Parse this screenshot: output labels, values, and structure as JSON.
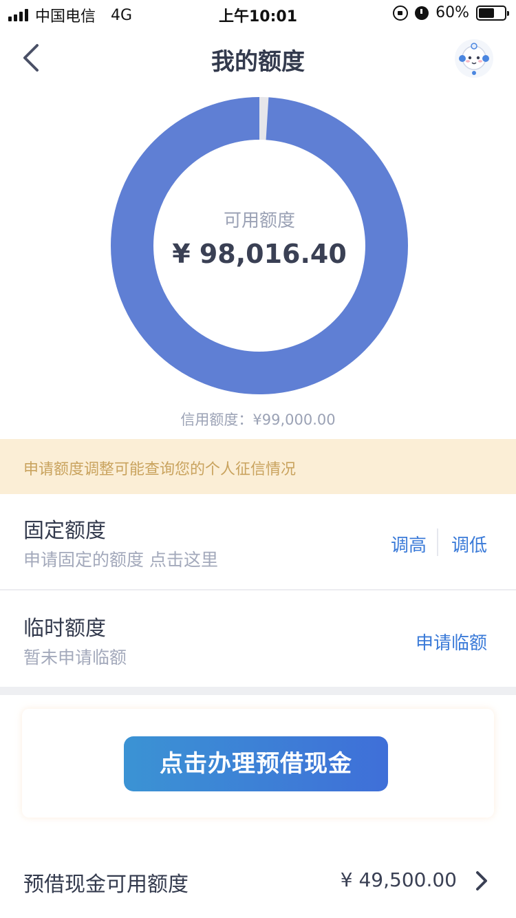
{
  "status_bar": {
    "carrier": "中国电信",
    "network": "4G",
    "time": "上午10:01",
    "battery": "60%",
    "battery_level": 0.6
  },
  "nav": {
    "title": "我的额度"
  },
  "donut": {
    "label": "可用额度",
    "available": "¥ 98,016.40",
    "available_value": 98016.4,
    "total_value": 99000.0,
    "used_color": "#e6e6ea",
    "available_color": "#5f7fd4"
  },
  "credit_line": "信用额度：¥99,000.00",
  "notice": "申请额度调整可能查询您的个人征信情况",
  "fixed": {
    "title": "固定额度",
    "sub": "申请固定的额度 点击这里",
    "raise": "调高",
    "lower": "调低"
  },
  "temp": {
    "title": "临时额度",
    "sub": "暂未申请临额",
    "apply": "申请临额"
  },
  "promo": {
    "button": "点击办理预借现金"
  },
  "cash": {
    "title": "预借现金可用额度",
    "value": "¥ 49,500.00"
  }
}
